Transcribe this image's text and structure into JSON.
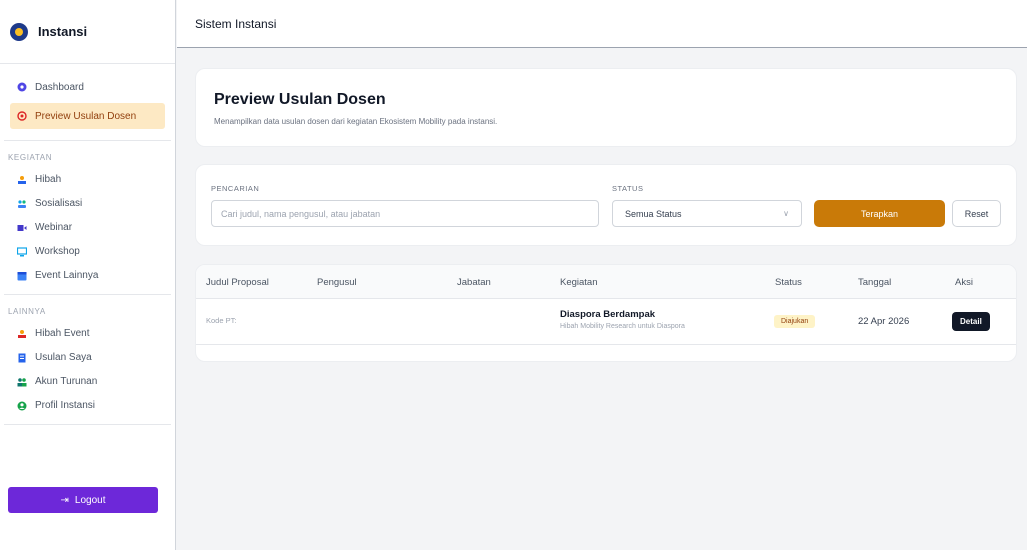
{
  "app": {
    "name": "Instansi",
    "topbar_title": "Sistem Instansi"
  },
  "sidebar": {
    "main_items": [
      {
        "label": "Dashboard",
        "icon": "dashboard-icon"
      },
      {
        "label": "Preview Usulan Dosen",
        "icon": "preview-icon",
        "active": true
      }
    ],
    "kegiatan_label": "KEGIATAN",
    "kegiatan_items": [
      {
        "label": "Hibah",
        "icon": "hibah-icon"
      },
      {
        "label": "Sosialisasi",
        "icon": "sosialisasi-icon"
      },
      {
        "label": "Webinar",
        "icon": "webinar-icon"
      },
      {
        "label": "Workshop",
        "icon": "workshop-icon"
      },
      {
        "label": "Event Lainnya",
        "icon": "event-icon"
      }
    ],
    "lainnya_label": "LAINNYA",
    "lainnya_items": [
      {
        "label": "Hibah Event",
        "icon": "hibah-event-icon"
      },
      {
        "label": "Usulan Saya",
        "icon": "usulan-icon"
      },
      {
        "label": "Akun Turunan",
        "icon": "akun-icon"
      },
      {
        "label": "Profil Instansi",
        "icon": "profil-icon"
      }
    ],
    "logout_label": "Logout"
  },
  "header": {
    "title": "Preview Usulan Dosen",
    "description": "Menampilkan data usulan dosen dari kegiatan Ekosistem Mobility pada instansi."
  },
  "filter": {
    "search_label": "PENCARIAN",
    "search_placeholder": "Cari judul, nama pengusul, atau jabatan",
    "status_label": "STATUS",
    "status_value": "Semua Status",
    "apply_label": "Terapkan",
    "reset_label": "Reset"
  },
  "table": {
    "columns": [
      "Judul Proposal",
      "Pengusul",
      "Jabatan",
      "Kegiatan",
      "Status",
      "Tanggal",
      "Aksi"
    ],
    "rows": [
      {
        "judul": "",
        "kode": "Kode PT:",
        "pengusul": "",
        "jabatan": "",
        "kegiatan_title": "Diaspora Berdampak",
        "kegiatan_sub": "Hibah Mobility Research untuk Diaspora",
        "status": "Diajukan",
        "tanggal": "22 Apr 2026",
        "aksi": "Detail"
      }
    ]
  },
  "colors": {
    "accent": "#c97a08",
    "active_bg": "#fde9c4",
    "logout": "#6d28d9",
    "dark_button": "#111827",
    "badge_bg": "#fef3c7"
  }
}
